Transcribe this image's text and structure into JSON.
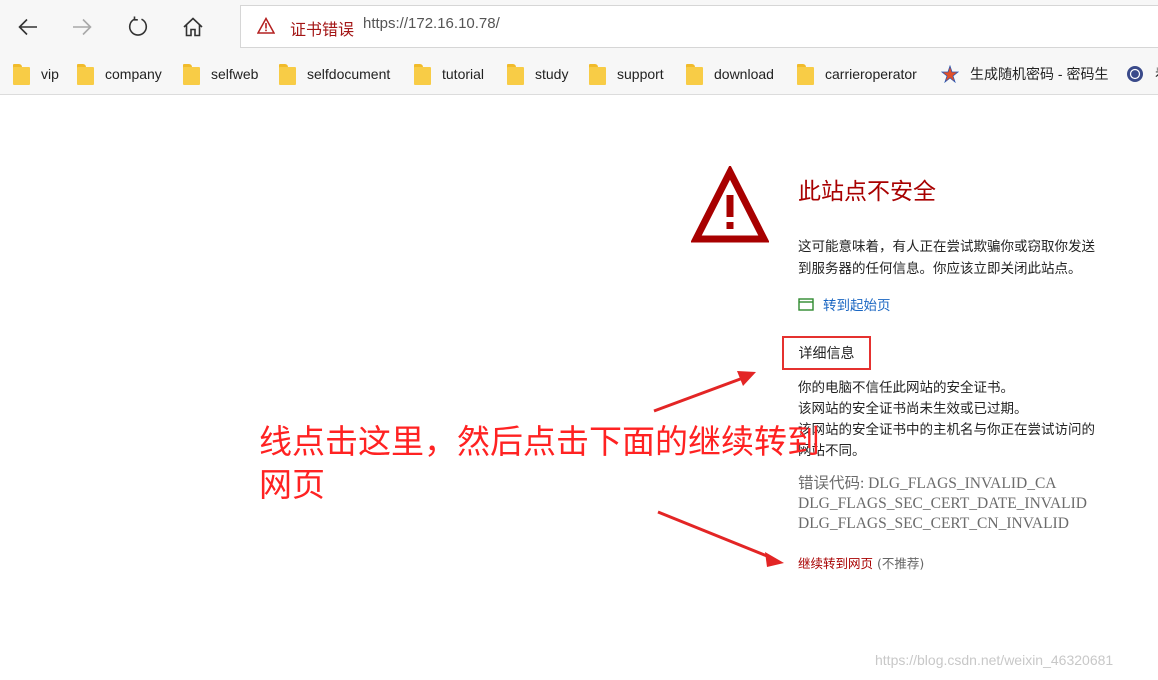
{
  "toolbar": {
    "address_label": "证书错误",
    "address_url": "https://172.16.10.78/"
  },
  "favorites": [
    {
      "label": "vip",
      "icon": "folder-icon"
    },
    {
      "label": "company",
      "icon": "folder-icon"
    },
    {
      "label": "selfweb",
      "icon": "folder-icon"
    },
    {
      "label": "selfdocument",
      "icon": "folder-icon"
    },
    {
      "label": "tutorial",
      "icon": "folder-icon"
    },
    {
      "label": "study",
      "icon": "folder-icon"
    },
    {
      "label": "support",
      "icon": "folder-icon"
    },
    {
      "label": "download",
      "icon": "folder-icon"
    },
    {
      "label": "carrieroperator",
      "icon": "folder-icon"
    },
    {
      "label": "生成随机密码 - 密码生",
      "icon": "site-favicon-icon"
    },
    {
      "label": "看",
      "icon": "site-favicon-icon"
    }
  ],
  "page": {
    "title": "此站点不安全",
    "description_lines": [
      "这可能意味着，有人正在尝试欺骗你或窃取你发送",
      "到服务器的任何信息。你应该立即关闭此站点。"
    ],
    "home_link": "转到起始页",
    "details_button": "详细信息",
    "detail_lines": [
      "你的电脑不信任此网站的安全证书。",
      "该网站的安全证书尚未生效或已过期。",
      "该网站的安全证书中的主机名与你正在尝试访问的",
      "网站不同。"
    ],
    "error_codes": [
      "错误代码: DLG_FLAGS_INVALID_CA",
      "DLG_FLAGS_SEC_CERT_DATE_INVALID",
      "DLG_FLAGS_SEC_CERT_CN_INVALID"
    ],
    "continue_link": "继续转到网页",
    "not_recommended": "(不推荐)"
  },
  "annotation": {
    "text": "线点击这里，然后点击下面的继续转到网页",
    "color": "#ff2222"
  },
  "watermark": "https://blog.csdn.net/weixin_46320681",
  "colors": {
    "title_red": "#a80000",
    "link_blue": "#1a66c2",
    "highlight_box": "#e5312f"
  }
}
